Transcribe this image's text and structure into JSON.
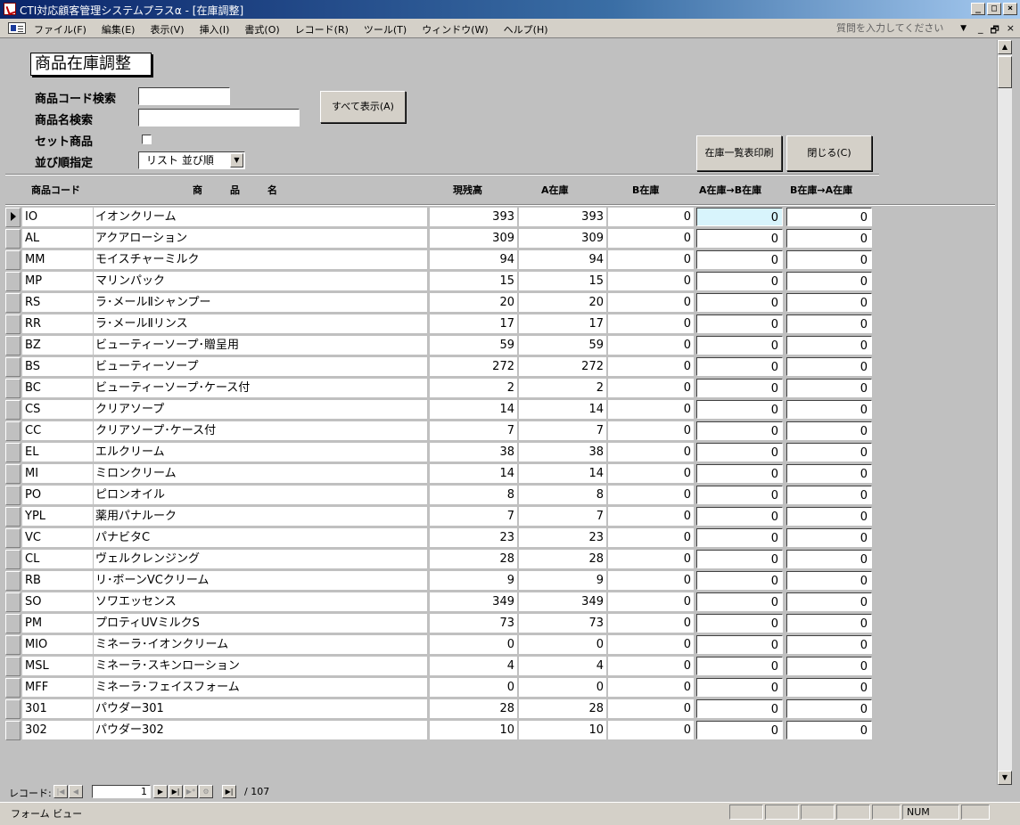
{
  "window": {
    "title": "CTI対応顧客管理システムプラスα - [在庫調整]",
    "minimize": "_",
    "maximize": "□",
    "close": "×"
  },
  "menu": {
    "items": [
      "ファイル(F)",
      "編集(E)",
      "表示(V)",
      "挿入(I)",
      "書式(O)",
      "レコード(R)",
      "ツール(T)",
      "ウィンドウ(W)",
      "ヘルプ(H)"
    ],
    "help_placeholder": "質問を入力してください",
    "mdi_min": "_",
    "mdi_restore": "🗗",
    "mdi_close": "×"
  },
  "form": {
    "title": "商品在庫調整",
    "code_search_label": "商品コード検索",
    "code_search_value": "",
    "name_search_label": "商品名検索",
    "name_search_value": "",
    "set_label": "セット商品",
    "set_checked": false,
    "sort_label": "並び順指定",
    "sort_value": "リスト 並び順",
    "show_all_button": "すべて表示(A)",
    "print_button": "在庫一覧表印刷",
    "close_button": "閉じる(C)"
  },
  "columns": {
    "code": "商品コード",
    "name": "商　　品　　名",
    "current": "現残高",
    "stock_a": "A在庫",
    "stock_b": "B在庫",
    "a_to_b": "A在庫→B在庫",
    "b_to_a": "B在庫→A在庫"
  },
  "rows": [
    {
      "code": "IO",
      "name": "イオンクリーム",
      "current": "393",
      "a": "393",
      "b": "0",
      "ab": "0",
      "ba": "0"
    },
    {
      "code": "AL",
      "name": "アクアローション",
      "current": "309",
      "a": "309",
      "b": "0",
      "ab": "0",
      "ba": "0"
    },
    {
      "code": "MM",
      "name": "モイスチャーミルク",
      "current": "94",
      "a": "94",
      "b": "0",
      "ab": "0",
      "ba": "0"
    },
    {
      "code": "MP",
      "name": "マリンパック",
      "current": "15",
      "a": "15",
      "b": "0",
      "ab": "0",
      "ba": "0"
    },
    {
      "code": "RS",
      "name": "ラ･メールⅡシャンプー",
      "current": "20",
      "a": "20",
      "b": "0",
      "ab": "0",
      "ba": "0"
    },
    {
      "code": "RR",
      "name": "ラ･メールⅡリンス",
      "current": "17",
      "a": "17",
      "b": "0",
      "ab": "0",
      "ba": "0"
    },
    {
      "code": "BZ",
      "name": "ビューティーソープ･贈呈用",
      "current": "59",
      "a": "59",
      "b": "0",
      "ab": "0",
      "ba": "0"
    },
    {
      "code": "BS",
      "name": "ビューティーソープ",
      "current": "272",
      "a": "272",
      "b": "0",
      "ab": "0",
      "ba": "0"
    },
    {
      "code": "BC",
      "name": "ビューティーソープ･ケース付",
      "current": "2",
      "a": "2",
      "b": "0",
      "ab": "0",
      "ba": "0"
    },
    {
      "code": "CS",
      "name": "クリアソープ",
      "current": "14",
      "a": "14",
      "b": "0",
      "ab": "0",
      "ba": "0"
    },
    {
      "code": "CC",
      "name": "クリアソープ･ケース付",
      "current": "7",
      "a": "7",
      "b": "0",
      "ab": "0",
      "ba": "0"
    },
    {
      "code": "EL",
      "name": "エルクリーム",
      "current": "38",
      "a": "38",
      "b": "0",
      "ab": "0",
      "ba": "0"
    },
    {
      "code": "MI",
      "name": "ミロンクリーム",
      "current": "14",
      "a": "14",
      "b": "0",
      "ab": "0",
      "ba": "0"
    },
    {
      "code": "PO",
      "name": "ピロンオイル",
      "current": "8",
      "a": "8",
      "b": "0",
      "ab": "0",
      "ba": "0"
    },
    {
      "code": "YPL",
      "name": "薬用パナルーク",
      "current": "7",
      "a": "7",
      "b": "0",
      "ab": "0",
      "ba": "0"
    },
    {
      "code": "VC",
      "name": "パナビタC",
      "current": "23",
      "a": "23",
      "b": "0",
      "ab": "0",
      "ba": "0"
    },
    {
      "code": "CL",
      "name": "ヴェルクレンジング",
      "current": "28",
      "a": "28",
      "b": "0",
      "ab": "0",
      "ba": "0"
    },
    {
      "code": "RB",
      "name": "リ･ボーンVCクリーム",
      "current": "9",
      "a": "9",
      "b": "0",
      "ab": "0",
      "ba": "0"
    },
    {
      "code": "SO",
      "name": "ソワエッセンス",
      "current": "349",
      "a": "349",
      "b": "0",
      "ab": "0",
      "ba": "0"
    },
    {
      "code": "PM",
      "name": "プロティUVミルクS",
      "current": "73",
      "a": "73",
      "b": "0",
      "ab": "0",
      "ba": "0"
    },
    {
      "code": "MIO",
      "name": "ミネーラ･イオンクリーム",
      "current": "0",
      "a": "0",
      "b": "0",
      "ab": "0",
      "ba": "0"
    },
    {
      "code": "MSL",
      "name": "ミネーラ･スキンローション",
      "current": "4",
      "a": "4",
      "b": "0",
      "ab": "0",
      "ba": "0"
    },
    {
      "code": "MFF",
      "name": "ミネーラ･フェイスフォーム",
      "current": "0",
      "a": "0",
      "b": "0",
      "ab": "0",
      "ba": "0"
    },
    {
      "code": "301",
      "name": "パウダー301",
      "current": "28",
      "a": "28",
      "b": "0",
      "ab": "0",
      "ba": "0"
    },
    {
      "code": "302",
      "name": "パウダー302",
      "current": "10",
      "a": "10",
      "b": "0",
      "ab": "0",
      "ba": "0"
    }
  ],
  "navigator": {
    "label": "レコード:",
    "current": "1",
    "total": "/ 107"
  },
  "status": {
    "view": "フォーム ビュー",
    "num": "NUM"
  }
}
